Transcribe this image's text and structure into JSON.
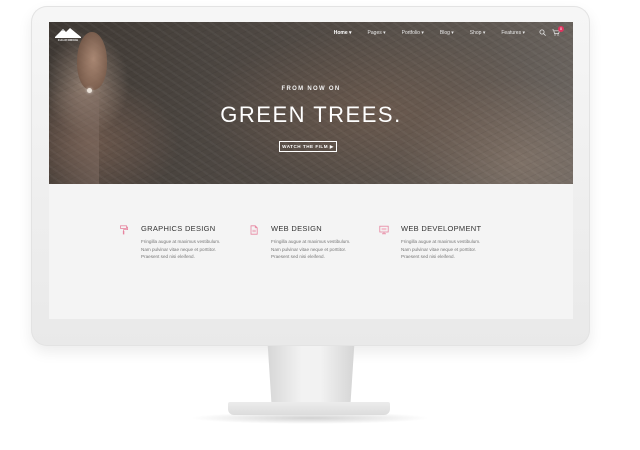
{
  "nav": {
    "logo_text": "CALIFORNIA",
    "items": [
      {
        "label": "Home ▾",
        "active": true
      },
      {
        "label": "Pages ▾",
        "active": false
      },
      {
        "label": "Portfolio ▾",
        "active": false
      },
      {
        "label": "Blog ▾",
        "active": false
      },
      {
        "label": "Shop ▾",
        "active": false
      },
      {
        "label": "Features ▾",
        "active": false
      }
    ],
    "cart_count": "0",
    "icons": [
      "search-icon",
      "cart-icon"
    ]
  },
  "hero": {
    "subtitle": "FROM NOW ON",
    "title": "GREEN TREES.",
    "button_label": "WATCH THE FILM ▶"
  },
  "features": [
    {
      "icon": "paint-roller-icon",
      "title": "GRAPHICS DESIGN",
      "lines": [
        "Fringilla augue at maximus vestibulum.",
        "Nam pulvinar vitae neque et porttitor.",
        "Praesent sed nisi eleifend."
      ]
    },
    {
      "icon": "document-icon",
      "title": "WEB DESIGN",
      "lines": [
        "Fringilla augue at maximus vestibulum.",
        "Nam pulvinar vitae neque et porttitor.",
        "Praesent sed nisi eleifend."
      ]
    },
    {
      "icon": "monitor-icon",
      "title": "WEB DEVELOPMENT",
      "lines": [
        "Fringilla augue at maximus vestibulum.",
        "Nam pulvinar vitae neque et porttitor.",
        "Praesent sed nisi eleifend."
      ]
    }
  ],
  "colors": {
    "accent": "#e0335f",
    "icon_pink": "#e7849f",
    "hero_dark": "#4b4540",
    "section_bg": "#f4f4f4"
  }
}
